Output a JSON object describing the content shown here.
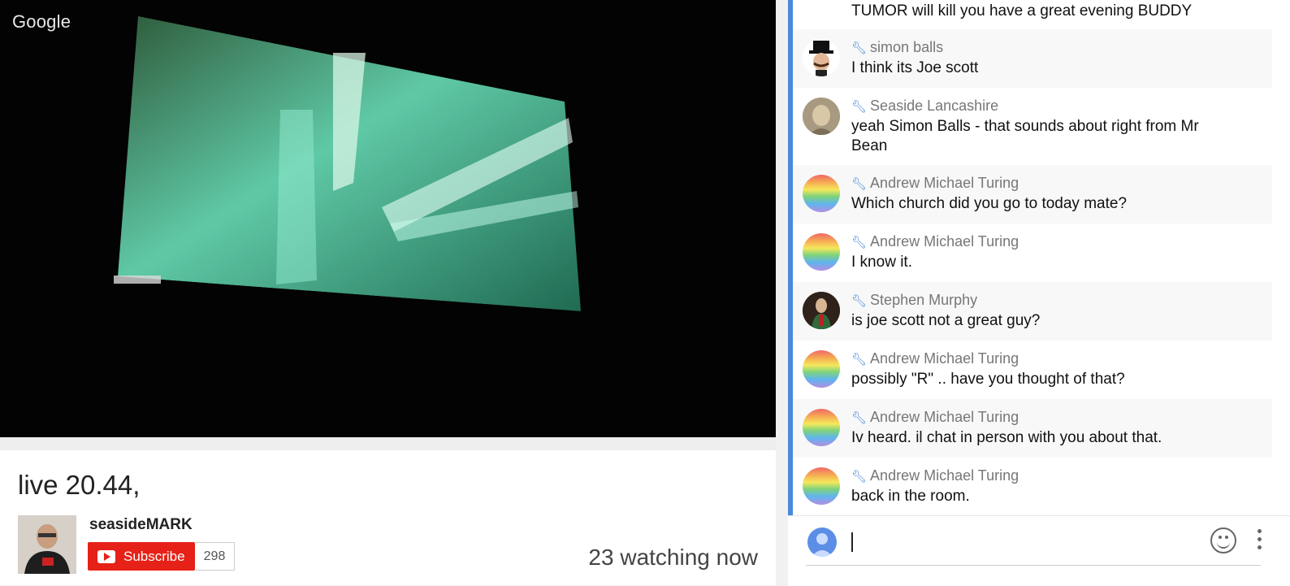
{
  "watermark": "Google",
  "video": {
    "title": "live 20.44,",
    "channel": "seasideMARK",
    "subscribe_label": "Subscribe",
    "subscriber_count": "298",
    "watching": "23 watching now"
  },
  "chat": {
    "messages": [
      {
        "author": "",
        "text": "TUMOR will kill you have a great evening BUDDY"
      },
      {
        "author": "simon balls",
        "text": "I think its Joe scott"
      },
      {
        "author": "Seaside Lancashire",
        "text": "yeah Simon Balls - that sounds about right from Mr Bean"
      },
      {
        "author": "Andrew Michael Turing",
        "text": "Which church did you go to today mate?"
      },
      {
        "author": "Andrew Michael Turing",
        "text": "I know it."
      },
      {
        "author": "Stephen Murphy",
        "text": "is joe scott not a great guy?"
      },
      {
        "author": "Andrew Michael Turing",
        "text": "possibly \"R\" .. have you thought of that?"
      },
      {
        "author": "Andrew Michael Turing",
        "text": "Iv heard. il chat in person with you about that."
      },
      {
        "author": "Andrew Michael Turing",
        "text": "back in the room."
      }
    ],
    "input_value": "",
    "wrench_icon": "wrench-icon"
  },
  "colors": {
    "subscribe": "#e62117",
    "accent": "#4a89dc"
  }
}
